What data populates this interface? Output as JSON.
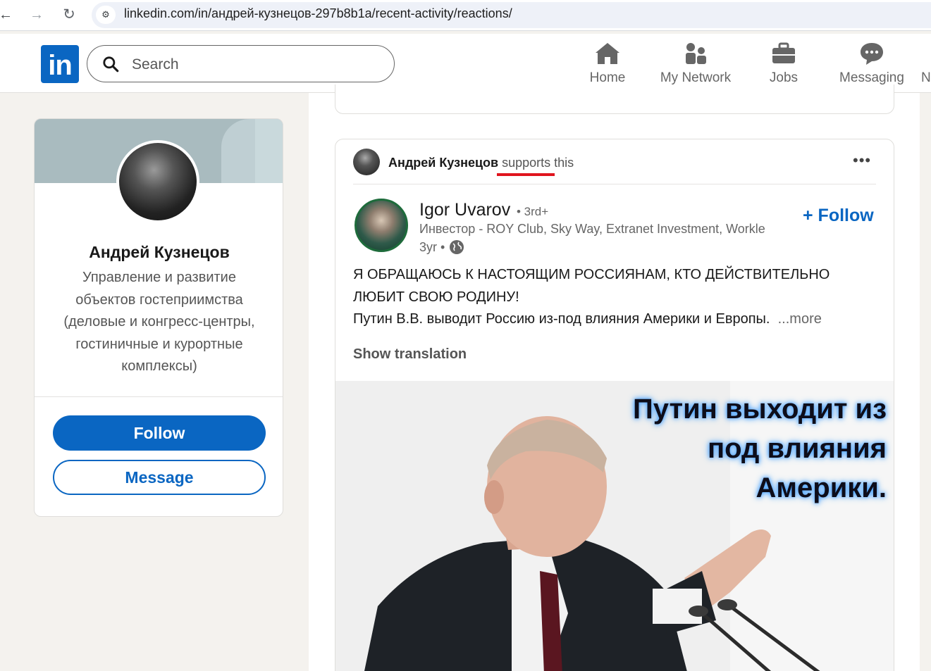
{
  "browser": {
    "back_glyph": "←",
    "forward_glyph": "→",
    "reload_glyph": "↻",
    "site_icon_glyph": "⚙",
    "url": "linkedin.com/in/андрей-кузнецов-297b8b1a/recent-activity/reactions/"
  },
  "header": {
    "logo_text": "in",
    "search_placeholder": "Search",
    "nav": [
      {
        "label": "Home",
        "icon": "home-icon"
      },
      {
        "label": "My Network",
        "icon": "network-icon"
      },
      {
        "label": "Jobs",
        "icon": "briefcase-icon"
      },
      {
        "label": "Messaging",
        "icon": "chat-icon"
      }
    ],
    "nav_overflow": "N",
    "brand_color": "#0a66c2"
  },
  "profile": {
    "name": "Андрей Кузнецов",
    "headline": "Управление и развитие объектов гостеприимства (деловые и конгресс-центры, гостиничные и курортные комплексы)",
    "follow_label": "Follow",
    "message_label": "Message"
  },
  "post": {
    "actor": "Андрей Кузнецов",
    "verb": "supports",
    "verb_suffix": "this",
    "menu_glyph": "•••",
    "author_name": "Igor Uvarov",
    "author_degree": "• 3rd+",
    "author_headline": "Инвестор - ROY Club, Sky Way, Extranet Investment, Workle",
    "author_age": "3yr •",
    "follow_label": "+ Follow",
    "text": "Я ОБРАЩАЮСЬ К НАСТОЯЩИМ РОССИЯНАМ, КТО ДЕЙСТВИТЕЛЬНО ЛЮБИТ СВОЮ РОДИНУ!",
    "text_line2": "Путин В.В. выводит Россию из-под влияния Америки и Европы.",
    "more_label": "...more",
    "show_translation": "Show translation",
    "image_caption_lines": [
      "Путин выходит из",
      "под влияния",
      "Америки."
    ],
    "highlight_color": "#e0141e"
  }
}
